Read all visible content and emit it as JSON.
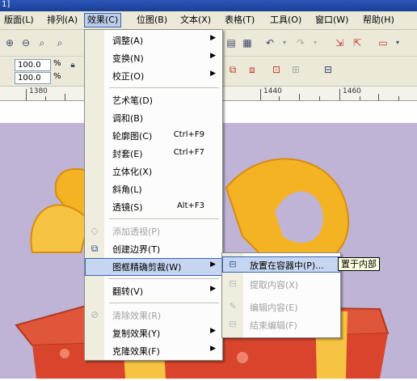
{
  "window": {
    "title_fragment": "1]"
  },
  "menubar": {
    "items": [
      {
        "label": "版面(L)"
      },
      {
        "label": "排列(A)"
      },
      {
        "label": "效果(C)"
      },
      {
        "label": "位图(B)"
      },
      {
        "label": "文本(X)"
      },
      {
        "label": "表格(T)"
      },
      {
        "label": "工具(O)"
      },
      {
        "label": "窗口(W)"
      },
      {
        "label": "帮助(H)"
      }
    ],
    "active_index": 2
  },
  "toolbar": {
    "width_value": "100.0",
    "height_value": "100.0",
    "percent": "%"
  },
  "ruler": {
    "labels": [
      "1380",
      "1440",
      "1460"
    ]
  },
  "effects_menu": {
    "items": [
      {
        "label": "调整(A)",
        "submenu": true
      },
      {
        "label": "变换(N)",
        "submenu": true
      },
      {
        "label": "校正(O)",
        "submenu": true
      },
      {
        "label": "艺术笔(D)"
      },
      {
        "label": "调和(B)"
      },
      {
        "label": "轮廓图(C)",
        "shortcut": "Ctrl+F9"
      },
      {
        "label": "封套(E)",
        "shortcut": "Ctrl+F7"
      },
      {
        "label": "立体化(X)"
      },
      {
        "label": "斜角(L)"
      },
      {
        "label": "透镜(S)",
        "shortcut": "Alt+F3"
      },
      {
        "label": "添加透视(P)",
        "disabled": true
      },
      {
        "label": "创建边界(T)"
      },
      {
        "label": "图框精确剪裁(W)",
        "submenu": true,
        "highlighted": true
      },
      {
        "label": "翻转(V)",
        "submenu": true
      },
      {
        "label": "清除效果(R)",
        "disabled": true
      },
      {
        "label": "复制效果(Y)",
        "submenu": true
      },
      {
        "label": "克隆效果(F)",
        "submenu": true
      }
    ]
  },
  "powerclip_submenu": {
    "items": [
      {
        "label": "放置在容器中(P)...",
        "highlighted": true
      },
      {
        "label": "提取内容(X)",
        "disabled": true
      },
      {
        "label": "编辑内容(E)",
        "disabled": true
      },
      {
        "label": "结束编辑(F)",
        "disabled": true
      }
    ]
  },
  "tooltip": {
    "text": "置于内部"
  },
  "colors": {
    "menu_bg": "#fcfcfc",
    "highlight": "#c6d6f1",
    "highlight_border": "#3665b3",
    "page_bg": "#bfb4d6",
    "ribbon": "#f4b323",
    "box": "#e0563a"
  }
}
